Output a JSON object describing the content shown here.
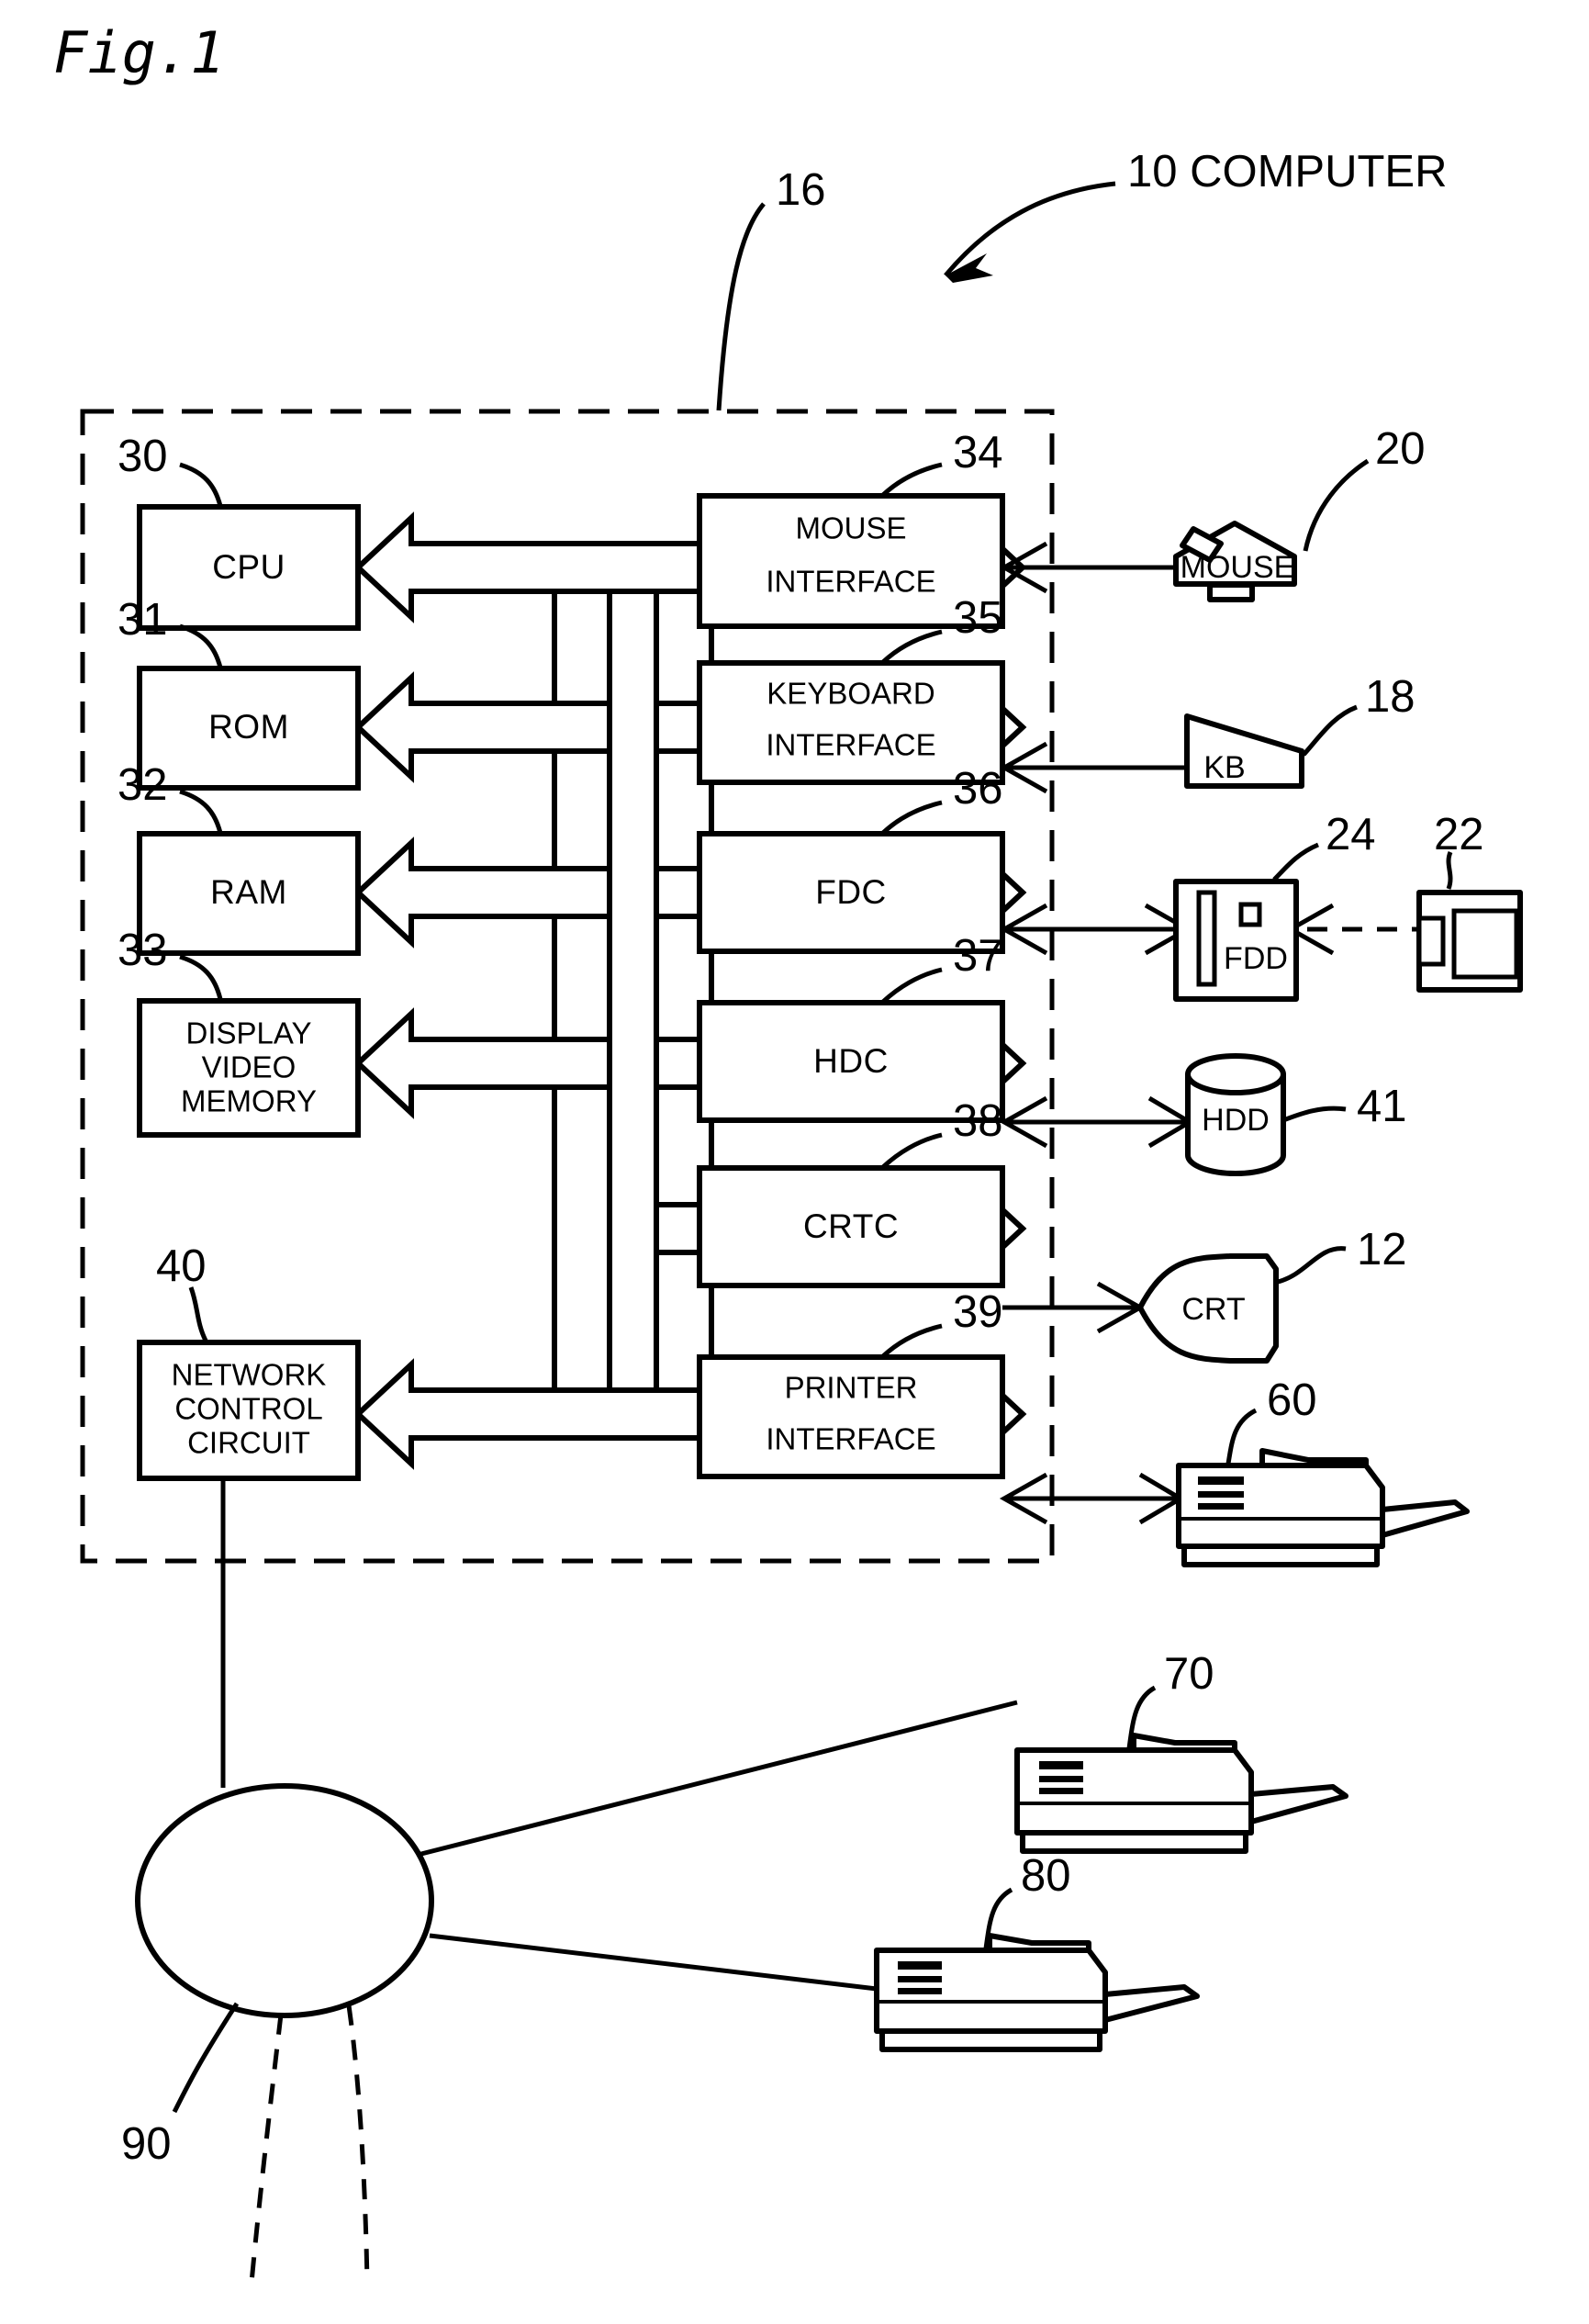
{
  "figure": {
    "title": "Fig.1",
    "overall_label": "10 COMPUTER",
    "main_unit_ref": "16"
  },
  "internal_blocks": [
    {
      "ref": "30",
      "label": "CPU",
      "lines": [
        "CPU"
      ]
    },
    {
      "ref": "31",
      "label": "ROM",
      "lines": [
        "ROM"
      ]
    },
    {
      "ref": "32",
      "label": "RAM",
      "lines": [
        "RAM"
      ]
    },
    {
      "ref": "33",
      "label": "DISPLAY VIDEO MEMORY",
      "lines": [
        "DISPLAY",
        "VIDEO",
        "MEMORY"
      ]
    },
    {
      "ref": "40",
      "label": "NETWORK CONTROL CIRCUIT",
      "lines": [
        "NETWORK",
        "CONTROL",
        "CIRCUIT"
      ]
    },
    {
      "ref": "34",
      "label": "MOUSE INTERFACE",
      "lines": [
        "MOUSE",
        "INTERFACE"
      ]
    },
    {
      "ref": "35",
      "label": "KEYBOARD INTERFACE",
      "lines": [
        "KEYBOARD",
        "INTERFACE"
      ]
    },
    {
      "ref": "36",
      "label": "FDC",
      "lines": [
        "FDC"
      ]
    },
    {
      "ref": "37",
      "label": "HDC",
      "lines": [
        "HDC"
      ]
    },
    {
      "ref": "38",
      "label": "CRTC",
      "lines": [
        "CRTC"
      ]
    },
    {
      "ref": "39",
      "label": "PRINTER INTERFACE",
      "lines": [
        "PRINTER",
        "INTERFACE"
      ]
    }
  ],
  "peripherals": [
    {
      "ref": "20",
      "label": "MOUSE",
      "shape": "mouse"
    },
    {
      "ref": "18",
      "label": "KB",
      "shape": "keyboard-wedge"
    },
    {
      "ref": "24",
      "label": "FDD",
      "shape": "floppy-drive"
    },
    {
      "ref": "22",
      "label": "",
      "shape": "floppy-disk"
    },
    {
      "ref": "41",
      "label": "HDD",
      "shape": "cylinder"
    },
    {
      "ref": "12",
      "label": "CRT",
      "shape": "crt-tube"
    },
    {
      "ref": "60",
      "label": "",
      "shape": "printer"
    },
    {
      "ref": "70",
      "label": "",
      "shape": "printer"
    },
    {
      "ref": "80",
      "label": "",
      "shape": "printer"
    },
    {
      "ref": "90",
      "label": "",
      "shape": "network-ellipse"
    }
  ],
  "refs": {
    "r10": "10 COMPUTER",
    "r12": "12",
    "r16": "16",
    "r18": "18",
    "r20": "20",
    "r22": "22",
    "r24": "24",
    "r30": "30",
    "r31": "31",
    "r32": "32",
    "r33": "33",
    "r34": "34",
    "r35": "35",
    "r36": "36",
    "r37": "37",
    "r38": "38",
    "r39": "39",
    "r40": "40",
    "r41": "41",
    "r60": "60",
    "r70": "70",
    "r80": "80",
    "r90": "90"
  },
  "labels": {
    "cpu": "CPU",
    "rom": "ROM",
    "ram": "RAM",
    "dvm1": "DISPLAY",
    "dvm2": "VIDEO",
    "dvm3": "MEMORY",
    "ncc1": "NETWORK",
    "ncc2": "CONTROL",
    "ncc3": "CIRCUIT",
    "mi1": "MOUSE",
    "mi2": "INTERFACE",
    "ki1": "KEYBOARD",
    "ki2": "INTERFACE",
    "fdc": "FDC",
    "hdc": "HDC",
    "crtc": "CRTC",
    "pi1": "PRINTER",
    "pi2": "INTERFACE",
    "mouse": "MOUSE",
    "kb": "KB",
    "fdd": "FDD",
    "hdd": "HDD",
    "crt": "CRT"
  },
  "colors": {
    "ink": "#000000",
    "paper": "#ffffff"
  }
}
